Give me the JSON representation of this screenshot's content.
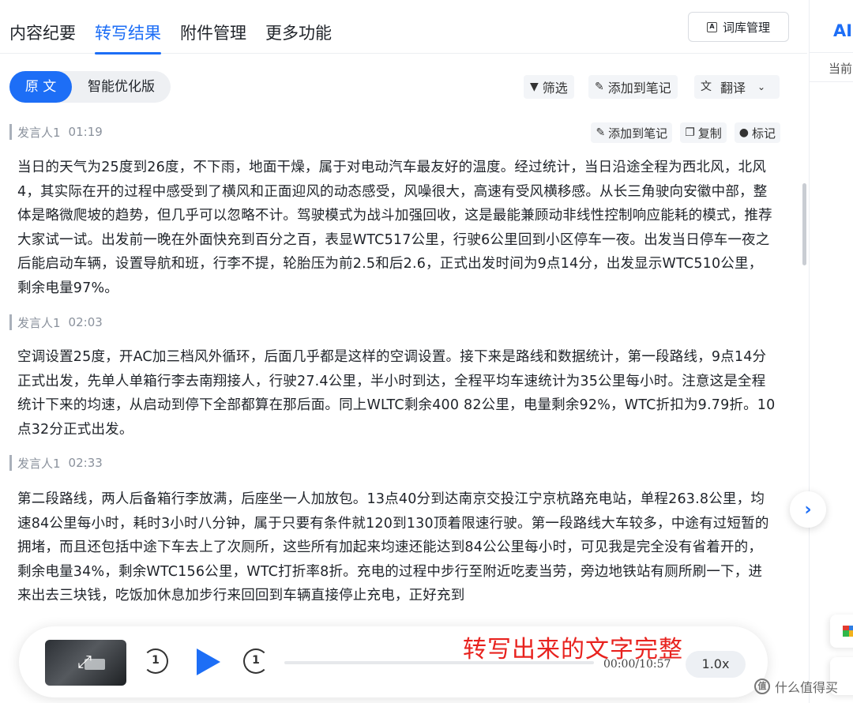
{
  "tabs": [
    "内容纪要",
    "转写结果",
    "附件管理",
    "更多功能"
  ],
  "active_tab": 1,
  "lexicon_button": "词库管理",
  "right_panel": {
    "title": "AI",
    "subtitle": "当前"
  },
  "mode_toggle": {
    "original": "原 文",
    "optimized": "智能优化版"
  },
  "toolbar": {
    "filter": "筛选",
    "add_note": "添加到笔记",
    "translate": "翻译"
  },
  "segment_actions": {
    "add_note": "添加到笔记",
    "copy": "复制",
    "mark": "标记"
  },
  "segments": [
    {
      "speaker": "发言人1",
      "time": "01:19",
      "text": "当日的天气为25度到26度，不下雨，地面干燥，属于对电动汽车最友好的温度。经过统计，当日沿途全程为西北风，北风4，其实际在开的过程中感受到了横风和正面迎风的动态感受，风噪很大，高速有受风横移感。从长三角驶向安徽中部，整体是略微爬坡的趋势，但几乎可以忽略不计。驾驶模式为战斗加强回收，这是最能兼顾动非线性控制响应能耗的模式，推荐大家试一试。出发前一晚在外面快充到百分之百，表显WTC517公里，行驶6公里回到小区停车一夜。出发当日停车一夜之后能启动车辆，设置导航和班，行李不提，轮胎压为前2.5和后2.6，正式出发时间为9点14分，出发显示WTC510公里，剩余电量97%。"
    },
    {
      "speaker": "发言人1",
      "time": "02:03",
      "text": "空调设置25度，开AC加三档风外循环，后面几乎都是这样的空调设置。接下来是路线和数据统计，第一段路线，9点14分正式出发，先单人单箱行李去南翔接人，行驶27.4公里，半小时到达，全程平均车速统计为35公里每小时。注意这是全程统计下来的均速，从启动到停下全部都算在那后面。同上WLTC剩余400 82公里，电量剩余92%，WTC折扣为9.79折。10点32分正式出发。"
    },
    {
      "speaker": "发言人1",
      "time": "02:33",
      "text": "第二段路线，两人后备箱行李放满，后座坐一人加放包。13点40分到达南京交投江宁京杭路充电站，单程263.8公里，均速84公里每小时，耗时3小时八分钟，属于只要有条件就120到130顶着限速行驶。第一段路线大车较多，中途有过短暂的拥堵，而且还包括中途下车去上了次厕所，这些所有加起来均速还能达到84公公里每小时，可见我是完全没有省着开的，剩余电量34%，剩余WTC156公里，WTC打折率8折。充电的过程中步行至附近吃麦当劳，旁边地铁站有厕所刷一下，进来出去三块钱，吃饭加休息加步行来回回到车辆直接停止充电，正好充到"
    }
  ],
  "player": {
    "rewind": "1",
    "forward": "1",
    "time_display": "00:00/10:57",
    "progress": 0,
    "speed": "1.0x"
  },
  "overlay_caption": "转写出来的文字完整",
  "watermark": "什么值得买",
  "colors": {
    "accent": "#1d6ef6",
    "caption": "#e8221e"
  }
}
